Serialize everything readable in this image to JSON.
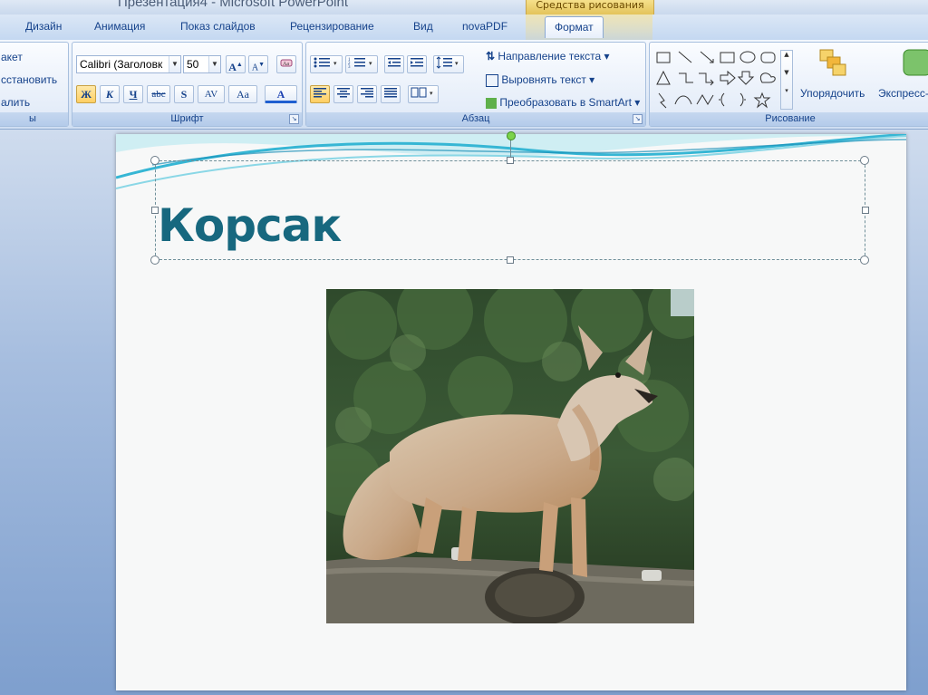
{
  "window": {
    "title": "Презентация4 - Microsoft PowerPoint",
    "context_tab_group": "Средства рисования"
  },
  "tabs": [
    {
      "label": "Дизайн"
    },
    {
      "label": "Анимация"
    },
    {
      "label": "Показ слайдов"
    },
    {
      "label": "Рецензирование"
    },
    {
      "label": "Вид"
    },
    {
      "label": "novaPDF"
    },
    {
      "label": "Формат"
    }
  ],
  "ribbon": {
    "slides_group": {
      "items": [
        "акет",
        "сстановить",
        "алить"
      ],
      "label": "ы"
    },
    "font_group": {
      "label": "Шрифт",
      "font_name": "Calibri (Заголовк",
      "font_size": "50",
      "buttons": {
        "bold": "Ж",
        "italic": "К",
        "underline": "Ч",
        "strike": "abc",
        "shadow": "S",
        "spacing": "AV",
        "case": "Aa",
        "color": "A"
      }
    },
    "paragraph_group": {
      "label": "Абзац",
      "text_direction": "Направление текста",
      "align_text": "Выровнять текст",
      "convert_smartart": "Преобразовать в SmartArt"
    },
    "drawing_group": {
      "label": "Рисование",
      "arrange": "Упорядочить",
      "quick_styles": "Экспресс-"
    }
  },
  "slide": {
    "title": "Корсак"
  },
  "colors": {
    "title_text": "#17687f",
    "ribbon_text": "#15428b"
  }
}
